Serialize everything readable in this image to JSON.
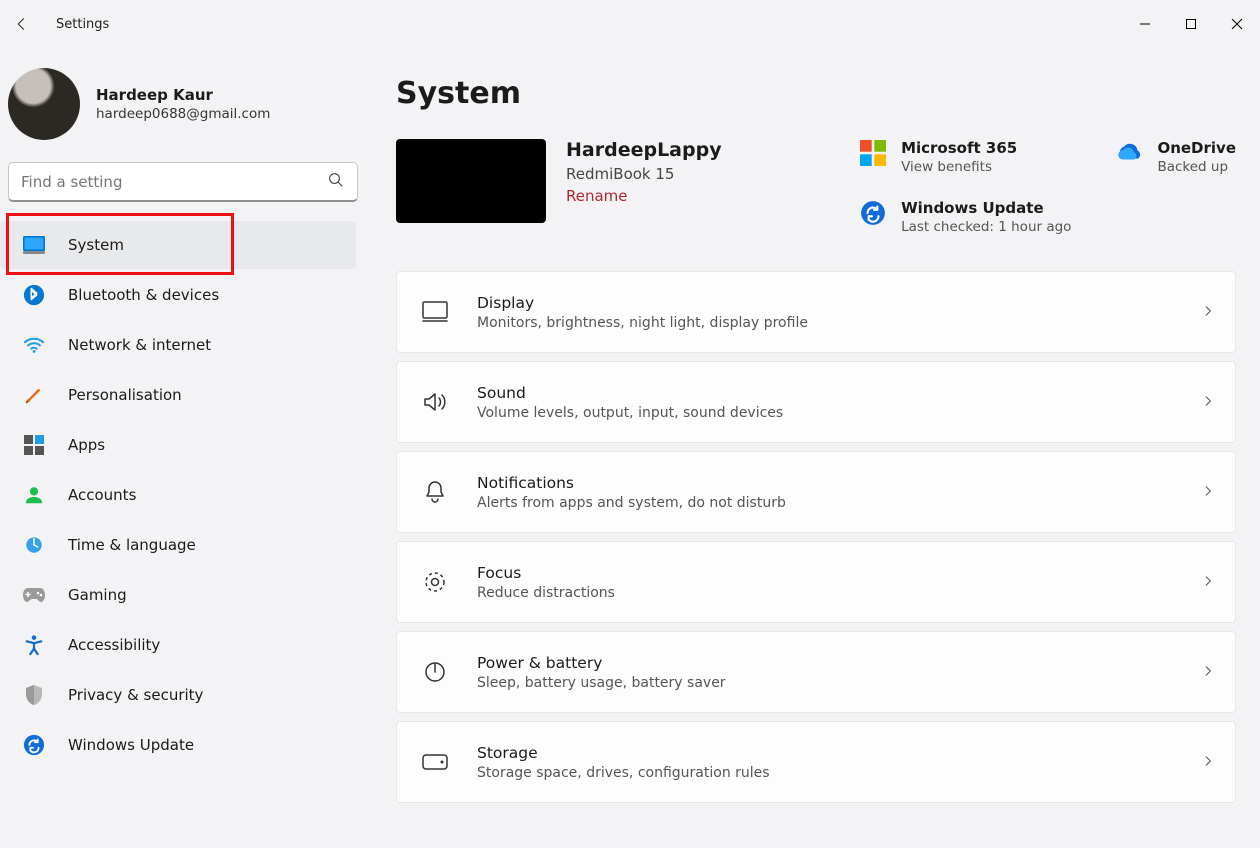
{
  "app": {
    "title": "Settings"
  },
  "user": {
    "name": "Hardeep Kaur",
    "email": "hardeep0688@gmail.com"
  },
  "search": {
    "placeholder": "Find a setting"
  },
  "nav": {
    "items": [
      {
        "id": "system",
        "label": "System"
      },
      {
        "id": "bluetooth",
        "label": "Bluetooth & devices"
      },
      {
        "id": "network",
        "label": "Network & internet"
      },
      {
        "id": "personal",
        "label": "Personalisation"
      },
      {
        "id": "apps",
        "label": "Apps"
      },
      {
        "id": "accounts",
        "label": "Accounts"
      },
      {
        "id": "time",
        "label": "Time & language"
      },
      {
        "id": "gaming",
        "label": "Gaming"
      },
      {
        "id": "accessibility",
        "label": "Accessibility"
      },
      {
        "id": "privacy",
        "label": "Privacy & security"
      },
      {
        "id": "update",
        "label": "Windows Update"
      }
    ],
    "selected": "system"
  },
  "page": {
    "title": "System",
    "device": {
      "name": "HardeepLappy",
      "model": "RedmiBook 15",
      "rename_label": "Rename"
    },
    "tiles": {
      "m365": {
        "title": "Microsoft 365",
        "sub": "View benefits"
      },
      "onedrive": {
        "title": "OneDrive",
        "sub": "Backed up"
      },
      "update": {
        "title": "Windows Update",
        "sub": "Last checked: 1 hour ago"
      }
    },
    "cards": [
      {
        "id": "display",
        "title": "Display",
        "sub": "Monitors, brightness, night light, display profile"
      },
      {
        "id": "sound",
        "title": "Sound",
        "sub": "Volume levels, output, input, sound devices"
      },
      {
        "id": "notifications",
        "title": "Notifications",
        "sub": "Alerts from apps and system, do not disturb"
      },
      {
        "id": "focus",
        "title": "Focus",
        "sub": "Reduce distractions"
      },
      {
        "id": "power",
        "title": "Power & battery",
        "sub": "Sleep, battery usage, battery saver"
      },
      {
        "id": "storage",
        "title": "Storage",
        "sub": "Storage space, drives, configuration rules"
      }
    ]
  }
}
